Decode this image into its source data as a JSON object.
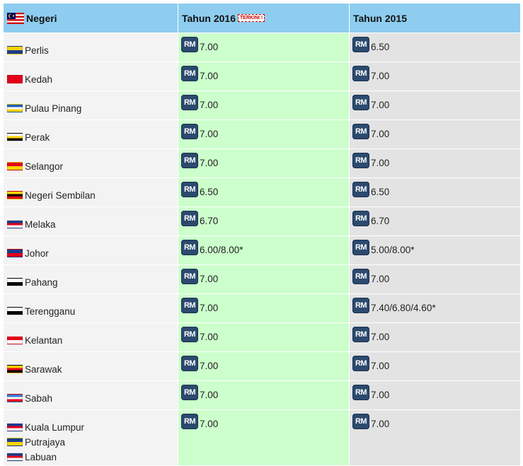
{
  "header": {
    "state": "Negeri",
    "y2016": "Tahun 2016",
    "badge": "TERKINI !",
    "y2015": "Tahun 2015"
  },
  "currency": "RM",
  "rows": [
    {
      "states": [
        "Perlis"
      ],
      "v2016": "7.00",
      "v2015": "6.50",
      "flags": [
        [
          "#ffd400",
          "#1a3c8c"
        ]
      ]
    },
    {
      "states": [
        "Kedah"
      ],
      "v2016": "7.00",
      "v2015": "7.00",
      "flags": [
        [
          "#e3001b",
          "#e3001b"
        ]
      ]
    },
    {
      "states": [
        "Pulau Pinang"
      ],
      "v2016": "7.00",
      "v2015": "7.00",
      "flags": [
        [
          "#1f5fbf",
          "#ffffff",
          "#ffd400"
        ]
      ]
    },
    {
      "states": [
        "Perak"
      ],
      "v2016": "7.00",
      "v2015": "7.00",
      "flags": [
        [
          "#ffffff",
          "#ffd400",
          "#000000"
        ]
      ]
    },
    {
      "states": [
        "Selangor"
      ],
      "v2016": "7.00",
      "v2015": "7.00",
      "flags": [
        [
          "#e3001b",
          "#ffd400"
        ]
      ]
    },
    {
      "states": [
        "Negeri Sembilan"
      ],
      "v2016": "6.50",
      "v2015": "6.50",
      "flags": [
        [
          "#ffd400",
          "#000000",
          "#e3001b"
        ]
      ]
    },
    {
      "states": [
        "Melaka"
      ],
      "v2016": "6.70",
      "v2015": "6.70",
      "flags": [
        [
          "#1a3c8c",
          "#e3001b",
          "#ffffff"
        ]
      ]
    },
    {
      "states": [
        "Johor"
      ],
      "v2016": "6.00/8.00*",
      "v2015": "5.00/8.00*",
      "flags": [
        [
          "#1a3c8c",
          "#e3001b"
        ]
      ]
    },
    {
      "states": [
        "Pahang"
      ],
      "v2016": "7.00",
      "v2015": "7.00",
      "flags": [
        [
          "#ffffff",
          "#000000"
        ]
      ]
    },
    {
      "states": [
        "Terengganu"
      ],
      "v2016": "7.00",
      "v2015": "7.40/6.80/4.60*",
      "flags": [
        [
          "#ffffff",
          "#000000"
        ]
      ]
    },
    {
      "states": [
        "Kelantan"
      ],
      "v2016": "7.00",
      "v2015": "7.00",
      "flags": [
        [
          "#e3001b",
          "#ffffff"
        ]
      ]
    },
    {
      "states": [
        "Sarawak"
      ],
      "v2016": "7.00",
      "v2015": "7.00",
      "flags": [
        [
          "#ffd400",
          "#e3001b",
          "#000000"
        ]
      ]
    },
    {
      "states": [
        "Sabah"
      ],
      "v2016": "7.00",
      "v2015": "7.00",
      "flags": [
        [
          "#3b7fd6",
          "#ffffff",
          "#e3001b"
        ]
      ]
    },
    {
      "states": [
        "Kuala Lumpur",
        "Putrajaya",
        "Labuan"
      ],
      "v2016": "7.00",
      "v2015": "7.00",
      "flags": [
        [
          "#1a3c8c",
          "#e3001b",
          "#ffffff"
        ],
        [
          "#1a3c8c",
          "#ffd400"
        ],
        [
          "#1a3c8c",
          "#e3001b",
          "#ffffff"
        ]
      ]
    }
  ]
}
